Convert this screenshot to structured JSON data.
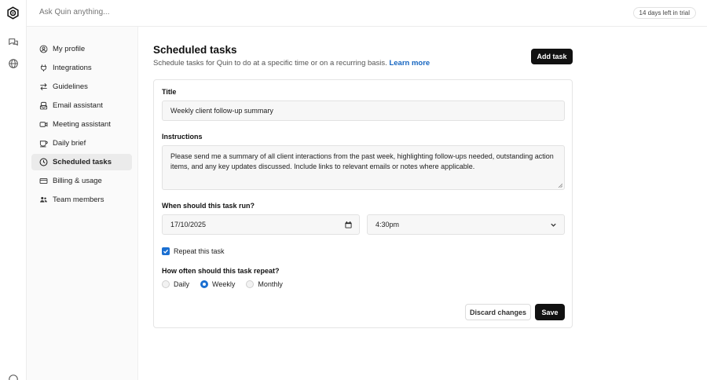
{
  "topbar": {
    "ask_placeholder": "Ask Quin anything...",
    "trial_badge": "14 days left in trial"
  },
  "nav": {
    "items": [
      {
        "label": "My profile",
        "icon": "user-circle-icon"
      },
      {
        "label": "Integrations",
        "icon": "plug-icon"
      },
      {
        "label": "Guidelines",
        "icon": "arrows-swap-icon"
      },
      {
        "label": "Email assistant",
        "icon": "mail-bot-icon"
      },
      {
        "label": "Meeting assistant",
        "icon": "video-icon"
      },
      {
        "label": "Daily brief",
        "icon": "coffee-cup-icon"
      },
      {
        "label": "Scheduled tasks",
        "icon": "clock-icon",
        "active": true
      },
      {
        "label": "Billing & usage",
        "icon": "credit-card-icon"
      },
      {
        "label": "Team members",
        "icon": "users-icon"
      }
    ]
  },
  "page": {
    "title": "Scheduled tasks",
    "subtitle": "Schedule tasks for Quin to do at a specific time or on a recurring basis.",
    "learn_more": "Learn more",
    "add_task": "Add task"
  },
  "form": {
    "title_label": "Title",
    "title_value": "Weekly client follow-up summary",
    "instructions_label": "Instructions",
    "instructions_value": "Please send me a summary of all client interactions from the past week, highlighting follow-ups needed, outstanding action items, and any key updates discussed. Include links to relevant emails or notes where applicable.",
    "when_label": "When should this task run?",
    "date_value": "17/10/2025",
    "time_value": "4:30pm",
    "repeat_label": "Repeat this task",
    "repeat_checked": true,
    "frequency_label": "How often should this task repeat?",
    "frequency_options": [
      "Daily",
      "Weekly",
      "Monthly"
    ],
    "frequency_selected": "Weekly",
    "discard": "Discard changes",
    "save": "Save"
  },
  "colors": {
    "accent": "#1a6fd1",
    "link": "#1565c0",
    "primary_button": "#111111"
  }
}
